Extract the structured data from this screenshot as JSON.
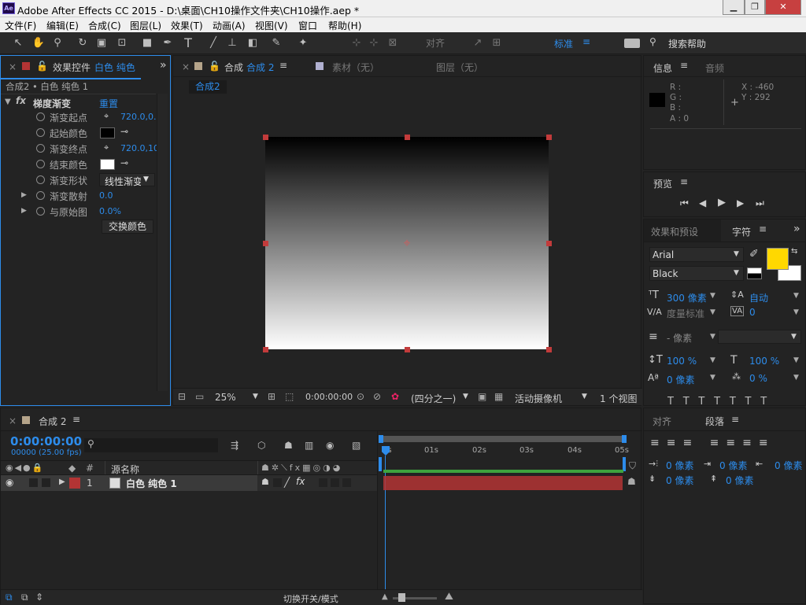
{
  "app": {
    "title": "Adobe After Effects CC 2015 - D:\\桌面\\CH10操作文件夹\\CH10操作.aep *",
    "icon_label": "Ae"
  },
  "window_controls": {
    "minimize": "▁",
    "restore": "❐",
    "close": "✕"
  },
  "menu": [
    "文件(F)",
    "编辑(E)",
    "合成(C)",
    "图层(L)",
    "效果(T)",
    "动画(A)",
    "视图(V)",
    "窗口",
    "帮助(H)"
  ],
  "toolbar": {
    "align_label": "对齐",
    "workspace_label": "标准",
    "search_help": "搜索帮助"
  },
  "effects_panel": {
    "tab_label": "效果控件",
    "tab_layer": "白色 纯色",
    "breadcrumb": "合成2 • 白色 纯色 1",
    "effect_name": "梯度渐变",
    "reset_label": "重置",
    "fx_label": "fx",
    "properties": [
      {
        "label": "渐变起点",
        "value": "720.0,0.0"
      },
      {
        "label": "起始颜色",
        "value": ""
      },
      {
        "label": "渐变终点",
        "value": "720.0,10"
      },
      {
        "label": "结束颜色",
        "value": ""
      },
      {
        "label": "渐变形状",
        "value": "线性渐变"
      },
      {
        "label": "渐变散射",
        "value": "0.0"
      },
      {
        "label": "与原始图",
        "value": "0.0%"
      }
    ],
    "swap_button": "交换颜色",
    "start_color": "#000000",
    "end_color": "#ffffff"
  },
  "comp_panel": {
    "tab_comp": "合成",
    "tab_comp_name": "合成 2",
    "tab_footage": "素材（无）",
    "tab_layer": "图层（无）",
    "comp_chip": "合成2",
    "zoom": "25%",
    "timecode": "0:00:00:00",
    "resolution": "(四分之一)",
    "camera": "活动摄像机",
    "views": "1 个视图"
  },
  "info_panel": {
    "tab_info": "信息",
    "tab_audio": "音频",
    "r": "R :",
    "g": "G :",
    "b": "B :",
    "a": "A : 0",
    "x": "X : -460",
    "y": "Y : 292"
  },
  "preview_panel": {
    "tab_label": "预览"
  },
  "character_panel": {
    "tab_effects": "效果和预设",
    "tab_char": "字符",
    "font": "Arial",
    "style": "Black",
    "font_size": "300 像素",
    "leading": "自动",
    "kerning_label": "度量标准",
    "tracking": "0",
    "stroke": "- 像素",
    "vscale": "100 %",
    "hscale": "100 %",
    "baseline": "0 像素",
    "tsume": "0 %",
    "fill_color": "#ffd800",
    "stroke_color": "#ffffff"
  },
  "timeline": {
    "tab_label": "合成 2",
    "timecode": "0:00:00:00",
    "frames": "00000 (25.00 fps)",
    "col_name": "源名称",
    "layer_num": "1",
    "layer_name": "白色 纯色 1",
    "ruler": [
      "0s",
      "01s",
      "02s",
      "03s",
      "04s",
      "05s"
    ],
    "switch_mode": "切换开关/模式",
    "layer_color": "#b33434"
  },
  "align_panel": {
    "tab_align": "对齐",
    "tab_para": "段落",
    "indent_left": "0 像素",
    "indent_first": "0 像素",
    "indent_right": "0 像素",
    "space_before": "0 像素",
    "space_after": "0 像素"
  }
}
